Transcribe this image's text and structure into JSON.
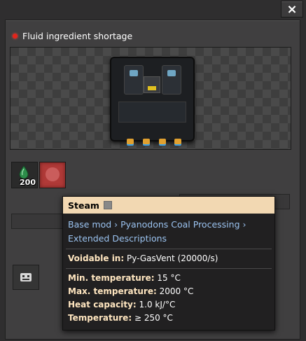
{
  "window": {
    "close_icon": "×"
  },
  "status": {
    "text": "Fluid ingredient shortage",
    "color": "#e3241b"
  },
  "ingredients": [
    {
      "name": "fluid-drop",
      "count": "200",
      "color": "#2d8c4a"
    }
  ],
  "tooltip": {
    "title": "Steam",
    "description": "Base mod › Pyanodons Coal Processing › Extended Descriptions",
    "voidable_label": "Voidable in:",
    "voidable_value": "Py-GasVent (20000/s)",
    "min_temp_label": "Min. temperature:",
    "min_temp_value": "15 °C",
    "max_temp_label": "Max. temperature:",
    "max_temp_value": "2000 °C",
    "heat_cap_label": "Heat capacity:",
    "heat_cap_value": "1.0 kJ/°C",
    "temperature_label": "Temperature:",
    "temperature_value": "≥ 250 °C"
  }
}
